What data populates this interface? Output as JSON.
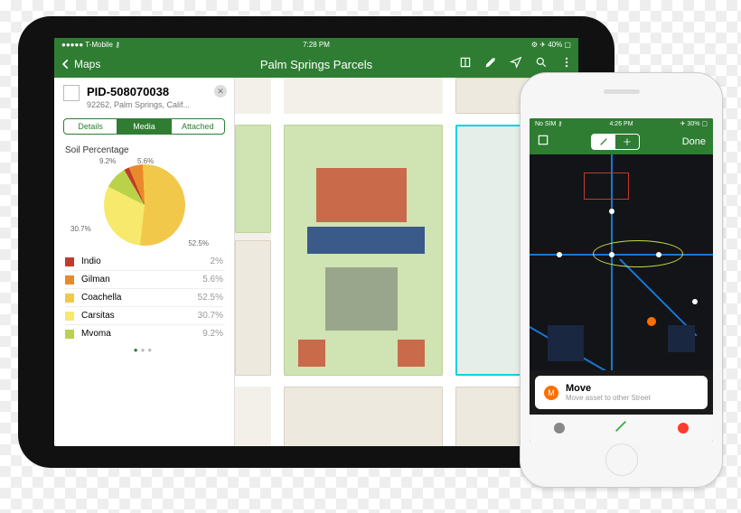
{
  "ipad": {
    "status": {
      "left": "●●●●● T-Mobile ⚷",
      "time": "7:28 PM",
      "right": "⚙ ✈ 40% ▢"
    },
    "nav": {
      "back_label": "Maps",
      "title": "Palm Springs Parcels"
    },
    "panel": {
      "pid": "PID-508070038",
      "subtitle": "92262, Palm Springs, Calif...",
      "tabs": [
        "Details",
        "Media",
        "Attached"
      ],
      "active_tab": 1,
      "section": "Soil Percentage",
      "legend": [
        {
          "name": "Indio",
          "value": "2%",
          "color": "#c13b2e"
        },
        {
          "name": "Gilman",
          "value": "5.6%",
          "color": "#e98a2a"
        },
        {
          "name": "Coachella",
          "value": "52.5%",
          "color": "#f2c84b"
        },
        {
          "name": "Carsitas",
          "value": "30.7%",
          "color": "#f6e96b"
        },
        {
          "name": "Mvoma",
          "value": "9.2%",
          "color": "#b9d24a"
        }
      ]
    }
  },
  "iphone": {
    "status": {
      "left": "No SIM ⚷",
      "time": "4:26 PM",
      "right": "✈ 30% ▢"
    },
    "nav": {
      "done": "Done"
    },
    "card": {
      "title": "Move",
      "subtitle": "Move asset to other Street"
    },
    "marker_label": "M"
  },
  "chart_data": {
    "type": "pie",
    "title": "Soil Percentage",
    "series": [
      {
        "name": "Indio",
        "value": 2.0,
        "color": "#c13b2e"
      },
      {
        "name": "Gilman",
        "value": 5.6,
        "color": "#e98a2a"
      },
      {
        "name": "Coachella",
        "value": 52.5,
        "color": "#f2c84b"
      },
      {
        "name": "Carsitas",
        "value": 30.7,
        "color": "#f6e96b"
      },
      {
        "name": "Mvoma",
        "value": 9.2,
        "color": "#b9d24a"
      }
    ],
    "labels_shown": [
      "9.2%",
      "5.6%",
      "52.5%",
      "30.7%"
    ]
  }
}
